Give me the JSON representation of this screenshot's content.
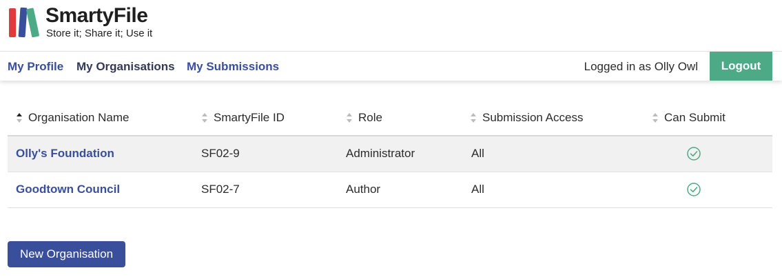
{
  "brand": {
    "name": "SmartyFile",
    "tagline": "Store it; Share it; Use it",
    "colors": [
      "#e23a3a",
      "#3a4f9c",
      "#4caa86"
    ]
  },
  "nav": {
    "links": [
      {
        "label": "My Profile"
      },
      {
        "label": "My Organisations"
      },
      {
        "label": "My Submissions"
      }
    ],
    "logged_in_text": "Logged in as Olly Owl",
    "logout_label": "Logout"
  },
  "table": {
    "headers": [
      "Organisation Name",
      "SmartyFile ID",
      "Role",
      "Submission Access",
      "Can Submit"
    ],
    "sort_state": [
      "asc",
      "none",
      "none",
      "none",
      "none"
    ],
    "rows": [
      {
        "name": "Olly's Foundation",
        "id": "SF02-9",
        "role": "Administrator",
        "access": "All",
        "can_submit": true
      },
      {
        "name": "Goodtown Council",
        "id": "SF02-7",
        "role": "Author",
        "access": "All",
        "can_submit": true
      }
    ]
  },
  "actions": {
    "new_org_label": "New Organisation"
  },
  "colors": {
    "link": "#3a4f9c",
    "accent_green": "#4caa86",
    "primary_button": "#3a4f9c"
  }
}
